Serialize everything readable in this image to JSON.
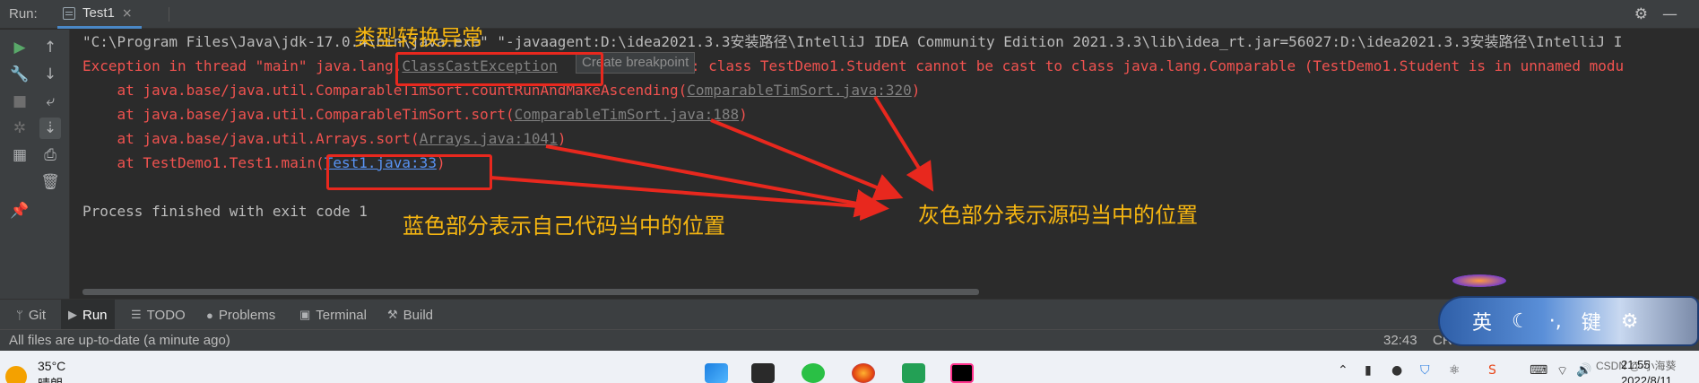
{
  "header": {
    "run_label": "Run:",
    "tab_title": "Test1",
    "tab_close": "×"
  },
  "console": {
    "command_line": "\"C:\\Program Files\\Java\\jdk-17.0.4\\bin\\java.exe\" \"-javaagent:D:\\idea2021.3.3安装路径\\IntelliJ IDEA Community Edition 2021.3.3\\lib\\idea_rt.jar=56027:D:\\idea2021.3.3安装路径\\IntelliJ I",
    "exception_prefix": "Exception in thread \"main\" java.lang.",
    "exception_class": "ClassCastException",
    "exception_message": ": class TestDemo1.Student cannot be cast to class java.lang.Comparable (TestDemo1.Student is in unnamed modu",
    "tooltip": "Create breakpoint",
    "stack": [
      {
        "prefix": "    at java.base/java.util.ComparableTimSort.countRunAndMakeAscending(",
        "link": "ComparableTimSort.java:320",
        "suffix": ")"
      },
      {
        "prefix": "    at java.base/java.util.ComparableTimSort.sort(",
        "link": "ComparableTimSort.java:188",
        "suffix": ")"
      },
      {
        "prefix": "    at java.base/java.util.Arrays.sort(",
        "link": "Arrays.java:1041",
        "suffix": ")"
      },
      {
        "prefix": "    at TestDemo1.Test1.main(",
        "link": "Test1.java:33",
        "suffix": ")"
      }
    ],
    "exit_line": "Process finished with exit code 1"
  },
  "annotations": {
    "exception_note": "类型转换异常",
    "own_code_note": "蓝色部分表示自己代码当中的位置",
    "source_note": "灰色部分表示源码当中的位置",
    "color": "#f6b611",
    "box_color": "#e8281e"
  },
  "tool_windows": [
    {
      "label": "Git",
      "icon": "git-branch-icon"
    },
    {
      "label": "Run",
      "icon": "play-icon",
      "active": true
    },
    {
      "label": "TODO",
      "icon": "list-icon"
    },
    {
      "label": "Problems",
      "icon": "info-icon"
    },
    {
      "label": "Terminal",
      "icon": "terminal-icon"
    },
    {
      "label": "Build",
      "icon": "hammer-icon"
    }
  ],
  "status": {
    "message": "All files are up-to-date (a minute ago)",
    "position": "32:43",
    "line_sep": "CR"
  },
  "ime": {
    "chars": [
      "英",
      "☾",
      "·,",
      "键",
      "⚙"
    ]
  },
  "taskbar": {
    "temp": "35°C",
    "weather": "晴朗",
    "time": "21:55",
    "date": "2022/8/11",
    "watermark": "CSDN @-小海葵"
  }
}
